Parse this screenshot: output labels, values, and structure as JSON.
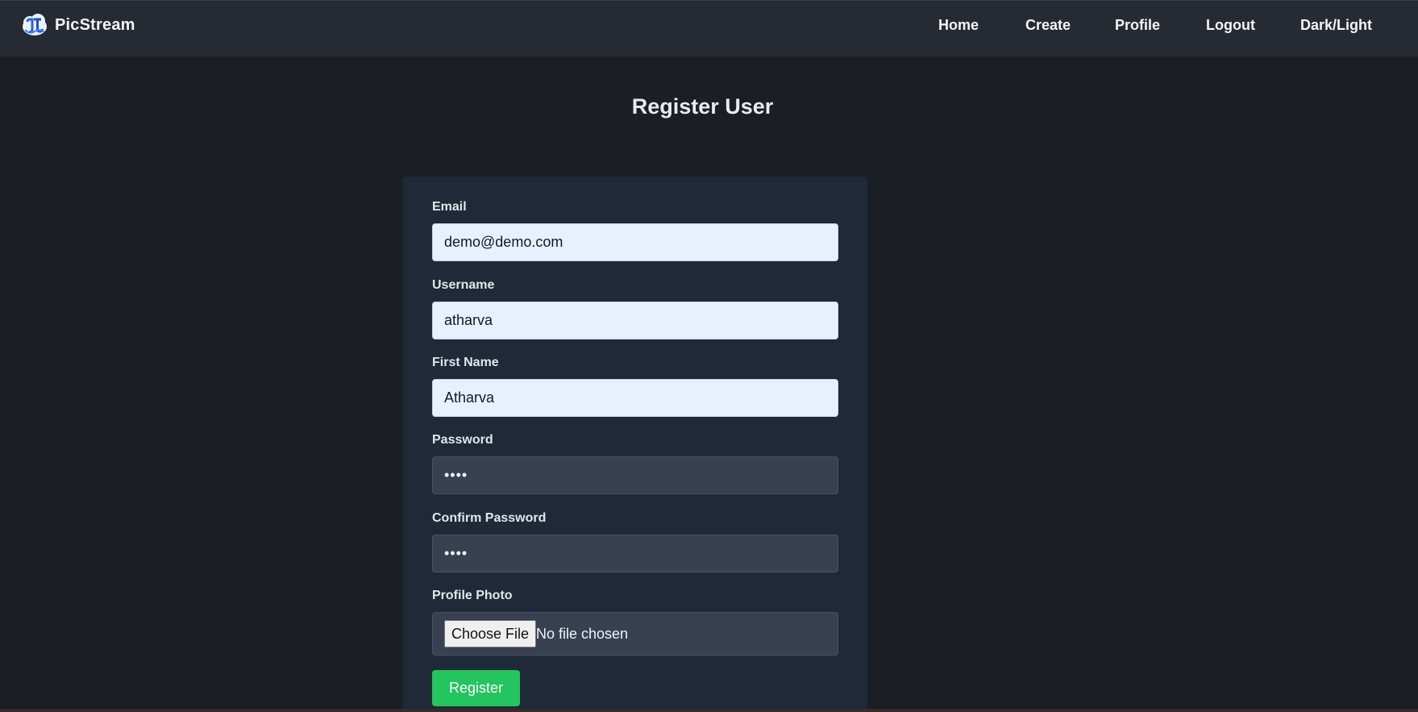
{
  "navbar": {
    "brand_name": "PicStream",
    "logo_icon": "picstream-cloud-logo-icon",
    "links": {
      "home": "Home",
      "create": "Create",
      "profile": "Profile",
      "logout": "Logout",
      "darklight": "Dark/Light"
    }
  },
  "page": {
    "title": "Register User"
  },
  "form": {
    "email": {
      "label": "Email",
      "value": "demo@demo.com"
    },
    "username": {
      "label": "Username",
      "value": "atharva"
    },
    "first_name": {
      "label": "First Name",
      "value": "Atharva"
    },
    "password": {
      "label": "Password",
      "value": "••••"
    },
    "confirm_password": {
      "label": "Confirm Password",
      "value": "••••"
    },
    "profile_photo": {
      "label": "Profile Photo",
      "button_label": "Choose File",
      "status": "No file chosen"
    },
    "submit_label": "Register"
  },
  "colors": {
    "background": "#1b1e24",
    "navbar": "#262b33",
    "card": "#1f2937",
    "accent_green": "#22c55e"
  }
}
